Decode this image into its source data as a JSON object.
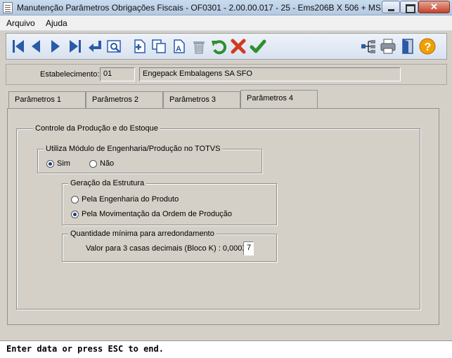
{
  "window": {
    "title": "Manutenção Parâmetros Obrigações Fiscais - OF0301 - 2.00.00.017 - 25 - Ems206B X 506 + MS...",
    "close_glyph": "✕"
  },
  "menu": {
    "items": [
      "Arquivo",
      "Ajuda"
    ]
  },
  "toolbar": {
    "buttons": [
      "first-icon",
      "prev-icon",
      "next-icon",
      "last-icon",
      "goto-icon",
      "search-icon",
      "add-icon",
      "copy-icon",
      "edit-icon",
      "delete-icon",
      "undo-icon",
      "cancel-icon",
      "save-icon",
      "relations-icon",
      "print-icon",
      "exit-icon",
      "help-icon"
    ]
  },
  "header": {
    "estabelecimento_label": "Estabelecimento:",
    "estabelecimento_code": "01",
    "estabelecimento_name": "Engepack Embalagens SA SFO"
  },
  "tabs": [
    {
      "label": "Parâmetros 1",
      "active": false
    },
    {
      "label": "Parâmetros 2",
      "active": false
    },
    {
      "label": "Parâmetros 3",
      "active": false
    },
    {
      "label": "Parâmetros 4",
      "active": true
    }
  ],
  "main": {
    "controle_title": "Controle da Produção e do Estoque",
    "modulo": {
      "title": "Utiliza Módulo de Engenharia/Produção no TOTVS",
      "options": [
        {
          "label": "Sim",
          "selected": true
        },
        {
          "label": "Não",
          "selected": false
        }
      ]
    },
    "estrutura": {
      "title": "Geração da Estrutura",
      "options": [
        {
          "label": "Pela Engenharia do Produto",
          "selected": false
        },
        {
          "label": "Pela Movimentação da Ordem de Produção",
          "selected": true
        }
      ]
    },
    "quantidade": {
      "title": "Quantidade mínima para arredondamento",
      "field_label": "Valor para 3 casas decimais (Bloco K) : 0,000X:",
      "field_value": "7"
    }
  },
  "status": {
    "text": "Enter data or press ESC to end."
  },
  "colors": {
    "accent": "#1b3e7e",
    "toolbar_blue": "#2a5aa8",
    "undo_green": "#2f8f2f",
    "cancel_red": "#d23a1e",
    "help_orange": "#f0a000"
  }
}
